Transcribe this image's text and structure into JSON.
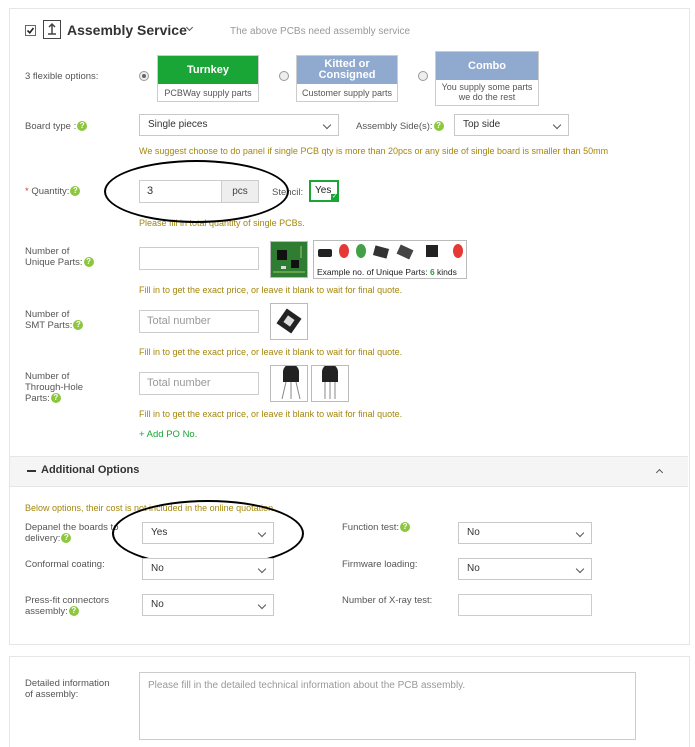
{
  "header": {
    "title": "Assembly Service",
    "note": "The above PCBs need assembly service"
  },
  "options": {
    "label": "3 flexible options:",
    "items": [
      {
        "title": "Turnkey",
        "sub": "PCBWay supply parts",
        "color": "#1aa637"
      },
      {
        "title": "Kitted or\nConsigned",
        "sub": "Customer supply parts",
        "color": "#8fa9cf"
      },
      {
        "title": "Combo",
        "sub": "You supply some parts\nwe do the rest",
        "color": "#8fa9cf"
      }
    ]
  },
  "board_type": {
    "label": "Board type :",
    "value": "Single pieces"
  },
  "assembly_side": {
    "label": "Assembly Side(s):",
    "value": "Top side"
  },
  "panel_hint": "We suggest choose to do panel if single PCB qty is more than 20pcs or any side of single board is smaller than 50mm",
  "quantity": {
    "label": "Quantity:",
    "value": "3",
    "unit": "pcs",
    "hint": "Please fill in total quantity of single PCBs."
  },
  "stencil": {
    "label": "Stencil:",
    "value": "Yes"
  },
  "unique_parts": {
    "label1": "Number of",
    "label2": "Unique Parts:",
    "value": "",
    "example_text": "Example no. of Unique Parts:",
    "example_count": "6",
    "example_unit": "kinds",
    "hint": "Fill in to get the exact price, or leave it blank to wait for final quote."
  },
  "smt_parts": {
    "label1": "Number of",
    "label2": "SMT Parts:",
    "placeholder": "Total number",
    "hint": "Fill in to get the exact price, or leave it blank to wait for final quote."
  },
  "th_parts": {
    "label1": "Number of",
    "label2": "Through-Hole",
    "label3": "Parts:",
    "placeholder": "Total number",
    "hint": "Fill in to get the exact price, or leave it blank to wait for final quote."
  },
  "add_po": "+ Add PO No.",
  "additional": {
    "title": "Additional Options",
    "note": "Below options, their cost is not included in the online quotation",
    "depanel": {
      "label1": "Depanel the boards to",
      "label2": "delivery:",
      "value": "Yes"
    },
    "function_test": {
      "label": "Function test:",
      "value": "No"
    },
    "conformal": {
      "label": "Conformal coating:",
      "value": "No"
    },
    "firmware": {
      "label": "Firmware loading:",
      "value": "No"
    },
    "pressfit": {
      "label1": "Press-fit connectors",
      "label2": "assembly:",
      "value": "No"
    },
    "xray": {
      "label": "Number of X-ray test:",
      "value": ""
    }
  },
  "detailed": {
    "label1": "Detailed information",
    "label2": "of assembly:",
    "placeholder": "Please fill in the detailed technical information about the PCB assembly."
  },
  "colors": {
    "accent_green": "#1aa637",
    "hint_gold": "#a5860b",
    "help_green": "#8dc63f"
  }
}
